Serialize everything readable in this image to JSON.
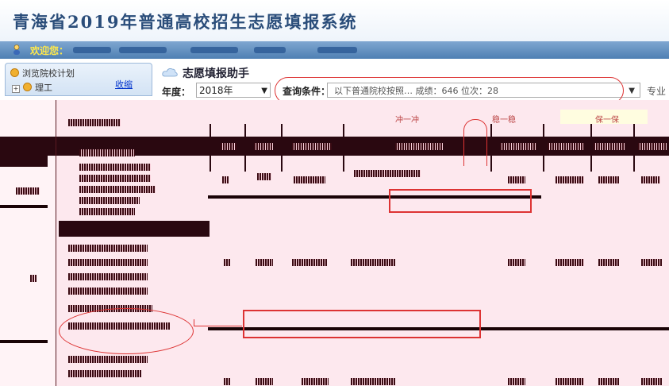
{
  "header": {
    "title": "青海省2019年普通高校招生志愿填报系统"
  },
  "welcome": {
    "label": "欢迎您："
  },
  "sidebar": {
    "browse_label": "浏览院校计划",
    "collapse_label": "收缩",
    "tree_first": "理工"
  },
  "helper": {
    "title": "志愿填报助手"
  },
  "filters": {
    "year_label": "年度：",
    "year_value": "2018年",
    "query_label": "查询条件：",
    "query_value": "以下普通院校按照…   成绩：646     位次：28",
    "spec_label": "专业"
  },
  "table": {
    "column_heads": [
      "冲一冲",
      "稳一稳",
      "保一保"
    ]
  },
  "colors": {
    "accent": "#2a4d7a",
    "annotation": "#dd3333",
    "band": "#4f7fb3"
  }
}
